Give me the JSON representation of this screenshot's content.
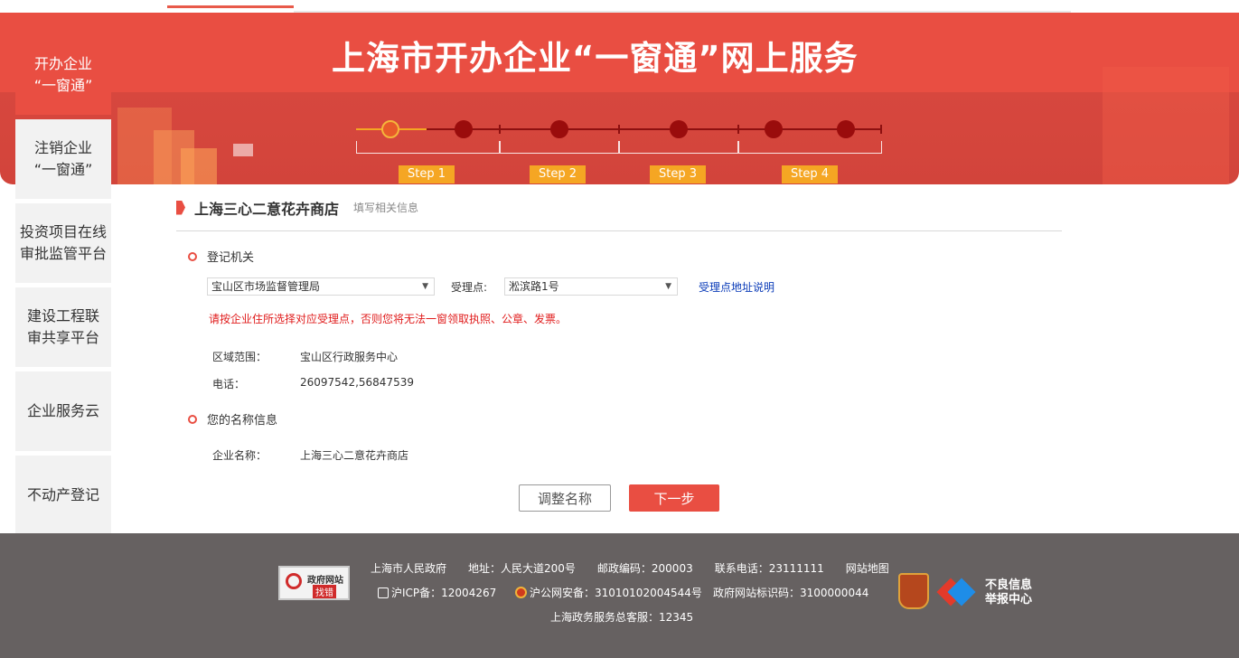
{
  "banner": {
    "title": "上海市开办企业“一窗通”网上服务",
    "steps": [
      "Step 1",
      "Step 2",
      "Step 3",
      "Step 4"
    ],
    "current_step": 1
  },
  "sidebar": {
    "items": [
      {
        "label_line1": "开办企业",
        "label_line2": "“一窗通”"
      },
      {
        "label_line1": "注销企业",
        "label_line2": "“一窗通”"
      },
      {
        "label_line1": "投资项目在线",
        "label_line2": "审批监管平台"
      },
      {
        "label_line1": "建设工程联",
        "label_line2": "审共享平台"
      },
      {
        "label_line1": "企业服务云",
        "label_line2": ""
      },
      {
        "label_line1": "不动产登记",
        "label_line2": ""
      }
    ]
  },
  "form": {
    "shop_name": "上海三心二意花卉商店",
    "subtitle": "填写相关信息",
    "section_registration": "登记机关",
    "authority_select": "宝山区市场监督管理局",
    "acceptance_label": "受理点:",
    "acceptance_select": "淞滨路1号",
    "acceptance_link": "受理点地址说明",
    "warning": "请按企业住所选择对应受理点，否则您将无法一窗领取执照、公章、发票。",
    "area_label": "区域范围：",
    "area_value": "宝山区行政服务中心",
    "phone_label": "电话：",
    "phone_value": "26097542,56847539",
    "section_name": "您的名称信息",
    "company_label": "企业名称：",
    "company_value": "上海三心二意花卉商店",
    "adjust_button": "调整名称",
    "next_button": "下一步"
  },
  "footer": {
    "gov_badge_line1": "政府网站",
    "gov_badge_line2": "找错",
    "line1": "上海市人民政府　　地址：人民大道200号　　邮政编码：200003　　联系电话：23111111　　网站地图",
    "icp": "沪ICP备：12004267",
    "police": "沪公网安备：31010102004544号",
    "site_id": "政府网站标识码：3100000044",
    "hotline": "上海政务服务总客服：12345",
    "report_line1": "不良信息",
    "report_line2": "举报中心"
  },
  "colors": {
    "brand": "#e94e42",
    "step": "#f5a623",
    "footer": "#666161",
    "link": "#0a3bb8",
    "warning": "#e01c1c"
  }
}
